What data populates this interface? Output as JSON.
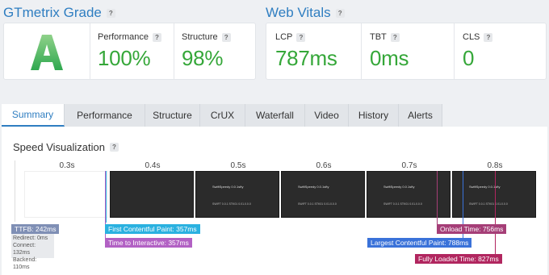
{
  "grade_section": {
    "title": "GTmetrix Grade",
    "grade": "A"
  },
  "grade_metrics": [
    {
      "label": "Performance",
      "value": "100%"
    },
    {
      "label": "Structure",
      "value": "98%"
    }
  ],
  "vitals_section": {
    "title": "Web Vitals"
  },
  "vitals": [
    {
      "label": "LCP",
      "value": "787ms"
    },
    {
      "label": "TBT",
      "value": "0ms"
    },
    {
      "label": "CLS",
      "value": "0"
    }
  ],
  "help_glyph": "?",
  "tabs": [
    "Summary",
    "Performance",
    "Structure",
    "CrUX",
    "Waterfall",
    "Video",
    "History",
    "Alerts"
  ],
  "active_tab": "Summary",
  "speed_viz": {
    "title": "Speed Visualization",
    "frame_labels": [
      "0.3s",
      "0.4s",
      "0.5s",
      "0.6s",
      "0.7s",
      "0.8s"
    ],
    "frame_text": {
      "line1": "SwiftSpeedy 0.0.1sfty",
      "line2": "SWIFT 0.0.1 STK01 0.01.0.0.0"
    },
    "ttfb": {
      "label": "TTFB: 242ms",
      "redirect": "Redirect: 0ms",
      "connect": "Connect: 132ms",
      "backend": "Backend: 110ms"
    },
    "markers": {
      "fcp": "First Contentful Paint: 357ms",
      "tti": "Time to Interactive: 357ms",
      "onload": "Onload Time: 756ms",
      "lcp": "Largest Contentful Paint: 788ms",
      "fully_loaded": "Fully Loaded Time: 827ms"
    }
  },
  "colors": {
    "brand_blue": "#2f7ec1",
    "grade_green": "#35a739",
    "ttfb": "#7f8fb5",
    "fcp": "#2ab1e0",
    "tti": "#b261c4",
    "onload": "#a53e77",
    "lcp": "#3a72d9",
    "fully_loaded": "#b1265f"
  }
}
